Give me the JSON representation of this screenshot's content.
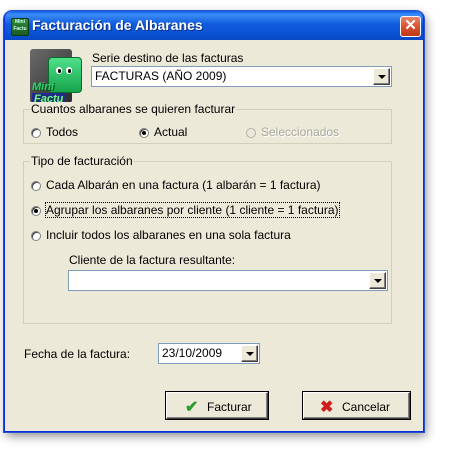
{
  "window": {
    "title": "Facturación de Albaranes",
    "icon": "mini-factu-icon",
    "close_label": "✕"
  },
  "logo": {
    "line1": "Mini",
    "line2": "Factu"
  },
  "serie": {
    "label": "Serie destino de las facturas",
    "value": "FACTURAS (AÑO 2009)"
  },
  "albaranes_group": {
    "legend": "Cuantos albaranes se quieren facturar",
    "options": [
      {
        "label": "Todos",
        "checked": false,
        "enabled": true
      },
      {
        "label": "Actual",
        "checked": true,
        "enabled": true
      },
      {
        "label": "Seleccionados",
        "checked": false,
        "enabled": false
      }
    ]
  },
  "tipo_group": {
    "legend": "Tipo de facturación",
    "options": [
      {
        "label": "Cada Albarán en una factura (1 albarán = 1 factura)",
        "checked": false
      },
      {
        "label": "Agrupar los albaranes por cliente (1 cliente = 1 factura)",
        "checked": true
      },
      {
        "label": "Incluir todos los albaranes en una sola factura",
        "checked": false
      }
    ],
    "cliente_label": "Cliente de la factura resultante:",
    "cliente_value": ""
  },
  "fecha": {
    "label": "Fecha de la factura:",
    "value": "23/10/2009"
  },
  "buttons": {
    "facturar": "Facturar",
    "cancelar": "Cancelar"
  },
  "colors": {
    "titlebar": "#0a51d3",
    "dialog_bg": "#ece9d8",
    "check_green": "#2a9d2a",
    "cancel_red": "#d21c1c"
  }
}
